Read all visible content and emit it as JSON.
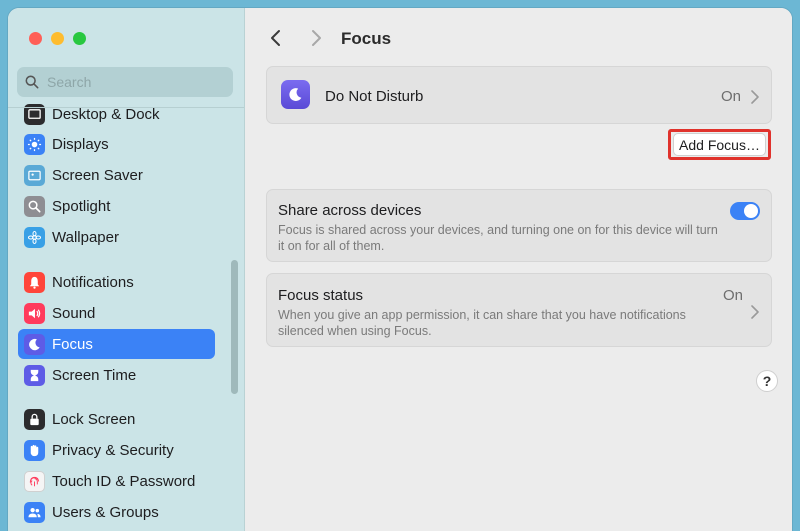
{
  "window": {
    "title": "Focus"
  },
  "search": {
    "placeholder": "Search"
  },
  "sidebar": {
    "items": [
      {
        "label": "Desktop & Dock",
        "icon": "desktop-dock-icon",
        "color": "#1d1d1f"
      },
      {
        "label": "Displays",
        "icon": "displays-icon",
        "color": "#3b82f6"
      },
      {
        "label": "Screen Saver",
        "icon": "screen-saver-icon",
        "color": "#5aa9d6"
      },
      {
        "label": "Spotlight",
        "icon": "spotlight-icon",
        "color": "#8e8e93"
      },
      {
        "label": "Wallpaper",
        "icon": "wallpaper-icon",
        "color": "#38a0e6"
      },
      {
        "label": "Notifications",
        "icon": "notifications-icon",
        "color": "#ff453a"
      },
      {
        "label": "Sound",
        "icon": "sound-icon",
        "color": "#ff3b5c"
      },
      {
        "label": "Focus",
        "icon": "focus-moon-icon",
        "color": "#5e5ce6",
        "selected": true
      },
      {
        "label": "Screen Time",
        "icon": "screen-time-icon",
        "color": "#5e5ce6"
      },
      {
        "label": "Lock Screen",
        "icon": "lock-screen-icon",
        "color": "#1d1d1f"
      },
      {
        "label": "Privacy & Security",
        "icon": "privacy-hand-icon",
        "color": "#3b82f6"
      },
      {
        "label": "Touch ID & Password",
        "icon": "touch-id-icon",
        "color": "#f5f5f5"
      },
      {
        "label": "Users & Groups",
        "icon": "users-groups-icon",
        "color": "#3b82f6"
      }
    ]
  },
  "main": {
    "dnd": {
      "label": "Do Not Disturb",
      "status": "On"
    },
    "add_focus_label": "Add Focus…",
    "share": {
      "title": "Share across devices",
      "description": "Focus is shared across your devices, and turning one on for this device will turn it on for all of them.",
      "enabled": true
    },
    "focus_status": {
      "title": "Focus status",
      "value": "On",
      "description": "When you give an app permission, it can share that you have notifications silenced when using Focus."
    },
    "help_label": "?"
  },
  "colors": {
    "accent": "#3b82f6",
    "sidebar_bg": "#cbe4e7",
    "highlight": "#e0322c"
  }
}
